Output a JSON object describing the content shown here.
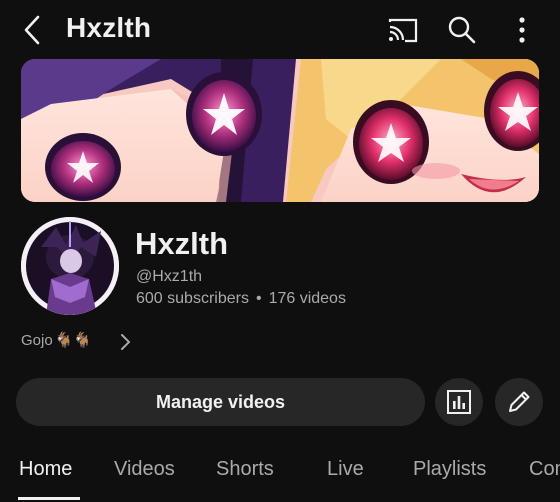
{
  "header": {
    "title": "Hxzlth",
    "icons": [
      "back-arrow-icon",
      "cast-icon",
      "search-icon",
      "more-vert-icon"
    ]
  },
  "channel": {
    "name": "Hxzlth",
    "handle": "@Hxz1th",
    "subscribers": "600 subscribers",
    "separator": "•",
    "videos": "176 videos",
    "description": "Gojo",
    "description_emoji": "🐐🐐"
  },
  "actions": {
    "manage_label": "Manage videos",
    "analytics_icon": "analytics-icon",
    "edit_icon": "pencil-icon"
  },
  "tabs": [
    {
      "label": "Home",
      "active": true
    },
    {
      "label": "Videos",
      "active": false
    },
    {
      "label": "Shorts",
      "active": false
    },
    {
      "label": "Live",
      "active": false
    },
    {
      "label": "Playlists",
      "active": false
    },
    {
      "label": "Com",
      "active": false
    }
  ],
  "colors": {
    "background": "#0f0f0f",
    "button": "#272727",
    "text_primary": "#f1f1f1",
    "text_secondary": "#aaaaaa"
  }
}
